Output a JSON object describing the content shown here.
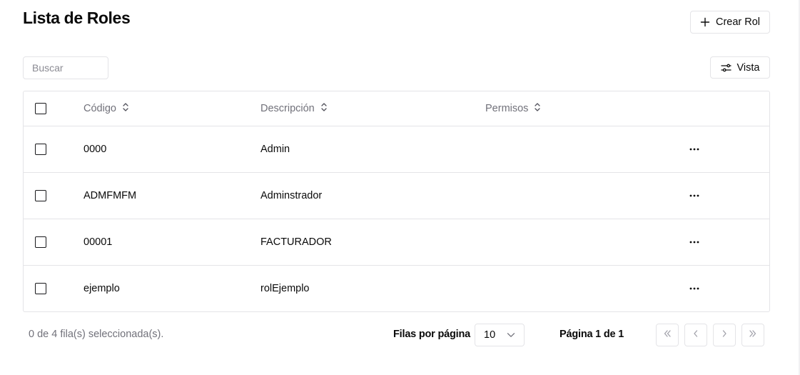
{
  "header": {
    "title": "Lista de Roles",
    "create_label": "Crear Rol"
  },
  "toolbar": {
    "search_placeholder": "Buscar",
    "view_label": "Vista"
  },
  "table": {
    "columns": [
      "Código",
      "Descripción",
      "Permisos"
    ],
    "rows": [
      {
        "codigo": "0000",
        "descripcion": "Admin",
        "permisos": ""
      },
      {
        "codigo": "ADMFMFM",
        "descripcion": "Adminstrador",
        "permisos": ""
      },
      {
        "codigo": "00001",
        "descripcion": "FACTURADOR",
        "permisos": ""
      },
      {
        "codigo": "ejemplo",
        "descripcion": "rolEjemplo",
        "permisos": ""
      }
    ]
  },
  "footer": {
    "selection_text": "0 de 4 fila(s) seleccionada(s).",
    "rows_per_page_label": "Filas por página",
    "rows_per_page_value": "10",
    "page_info": "Página 1 de 1"
  },
  "icons": {
    "create": "plus-icon",
    "view": "sliders-icon",
    "sort": "chevrons-up-down-icon",
    "row_actions": "more-horizontal-icon",
    "select": "chevron-down-icon",
    "first": "chevrons-left-icon",
    "prev": "chevron-left-icon",
    "next": "chevron-right-icon",
    "last": "chevrons-right-icon"
  },
  "colors": {
    "text": "#0a0a0a",
    "muted": "#71717a",
    "border": "#e4e4e7"
  }
}
